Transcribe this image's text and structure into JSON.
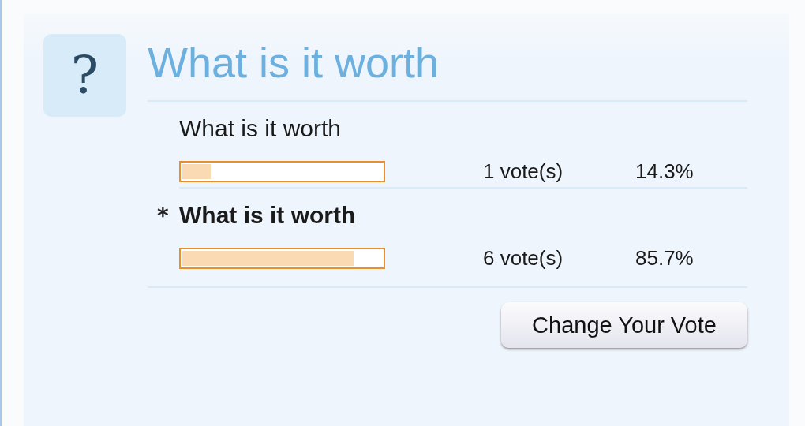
{
  "poll": {
    "icon": "?",
    "title": "What is it worth",
    "options": [
      {
        "label": "What is it worth",
        "selected": false,
        "level": 0.143,
        "votes": "1 vote(s)",
        "percent": "14.3%"
      },
      {
        "label": "What is it worth",
        "selected": true,
        "marker": "*",
        "level": 0.857,
        "votes": "6 vote(s)",
        "percent": "85.7%"
      }
    ],
    "button": "Change Your Vote"
  }
}
